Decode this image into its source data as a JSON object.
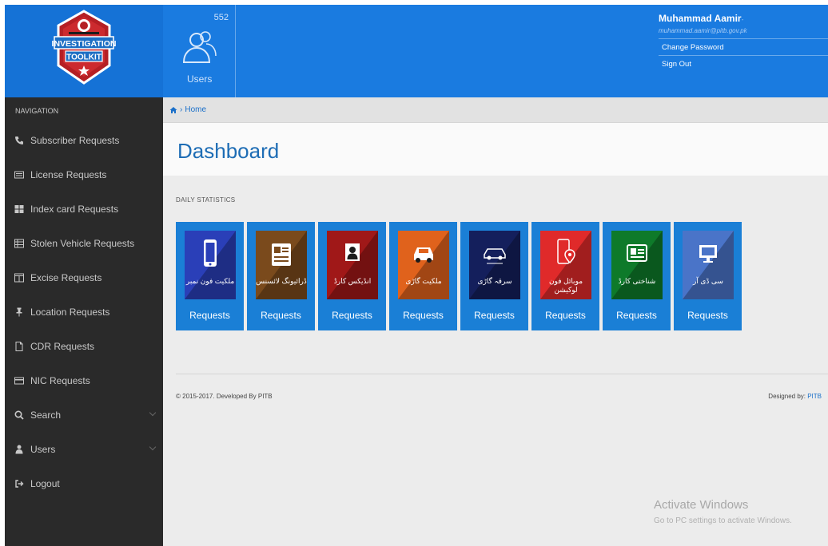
{
  "logo": {
    "line1": "INVESTIGATION",
    "line2": "TOOLKIT"
  },
  "header": {
    "users_count": "552",
    "users_label": "Users",
    "user_name": "Muhammad Aamir",
    "user_email": "- muhammad.aamir@pitb.gov.pk",
    "menu": [
      "Change Password",
      "Sign Out"
    ]
  },
  "sidebar": {
    "title": "NAVIGATION",
    "items": [
      {
        "label": "Subscriber Requests",
        "icon": "phone-icon"
      },
      {
        "label": "License Requests",
        "icon": "id-card-icon"
      },
      {
        "label": "Index card Requests",
        "icon": "grid-icon"
      },
      {
        "label": "Stolen Vehicle Requests",
        "icon": "table-icon"
      },
      {
        "label": "Excise Requests",
        "icon": "columns-icon"
      },
      {
        "label": "Location Requests",
        "icon": "pin-icon"
      },
      {
        "label": "CDR Requests",
        "icon": "file-icon"
      },
      {
        "label": "NIC Requests",
        "icon": "card-icon"
      },
      {
        "label": "Search",
        "icon": "search-icon"
      },
      {
        "label": "Users",
        "icon": "user-icon"
      },
      {
        "label": "Logout",
        "icon": "logout-icon"
      }
    ]
  },
  "breadcrumb": {
    "home": "Home"
  },
  "page": {
    "title": "Dashboard",
    "section": "DAILY STATISTICS"
  },
  "tiles": [
    {
      "urdu": "ملکیت فون نمبر",
      "label": "Requests",
      "color": "#2a3fb8",
      "icon": "mobile-icon"
    },
    {
      "urdu": "ڈرائیونگ لائسنس",
      "label": "Requests",
      "color": "#7a4a1c",
      "icon": "license-icon"
    },
    {
      "urdu": "انڈیکس کارڈ",
      "label": "Requests",
      "color": "#a01818",
      "icon": "index-card-icon"
    },
    {
      "urdu": "ملکیت گاڑی",
      "label": "Requests",
      "color": "#e0621c",
      "icon": "car-icon"
    },
    {
      "urdu": "سرقہ گاڑی",
      "label": "Requests",
      "color": "#141f5c",
      "icon": "stolen-car-icon"
    },
    {
      "urdu": "موبائل فون لوکیشن",
      "label": "Requests",
      "color": "#e02a2a",
      "icon": "location-phone-icon"
    },
    {
      "urdu": "شناختی کارڈ",
      "label": "Requests",
      "color": "#0e7a2a",
      "icon": "nic-icon"
    },
    {
      "urdu": "سی ڈی آر",
      "label": "Requests",
      "color": "#4a74c8",
      "icon": "cdr-monitor-icon"
    }
  ],
  "footer": {
    "left": "© 2015-2017. Developed By PITB",
    "right_prefix": "Designed by: ",
    "right_link": "PITB"
  },
  "watermark": {
    "line1": "Activate Windows",
    "line2": "Go to PC settings to activate Windows."
  }
}
